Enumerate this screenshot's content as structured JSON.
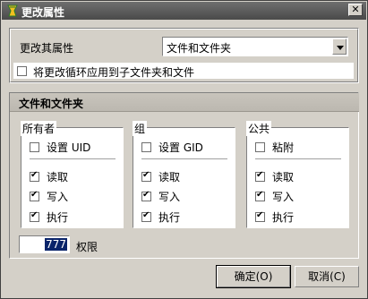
{
  "window": {
    "title": "更改属性",
    "close_label": "✕"
  },
  "change": {
    "label": "更改其属性",
    "select_value": "文件和文件夹",
    "recursive_label": "将更改循环应用到子文件夹和文件",
    "recursive_checked": false
  },
  "section_header": "文件和文件夹",
  "groups": [
    {
      "title": "所有者",
      "special": "设置 UID",
      "special_checked": false,
      "read": "读取",
      "write": "写入",
      "exec": "执行"
    },
    {
      "title": "组",
      "special": "设置 GID",
      "special_checked": false,
      "read": "读取",
      "write": "写入",
      "exec": "执行"
    },
    {
      "title": "公共",
      "special": "粘附",
      "special_checked": false,
      "read": "读取",
      "write": "写入",
      "exec": "执行"
    }
  ],
  "permissions": {
    "value": "777",
    "label": "权限"
  },
  "buttons": {
    "ok": "确定(O)",
    "cancel": "取消(C)"
  }
}
